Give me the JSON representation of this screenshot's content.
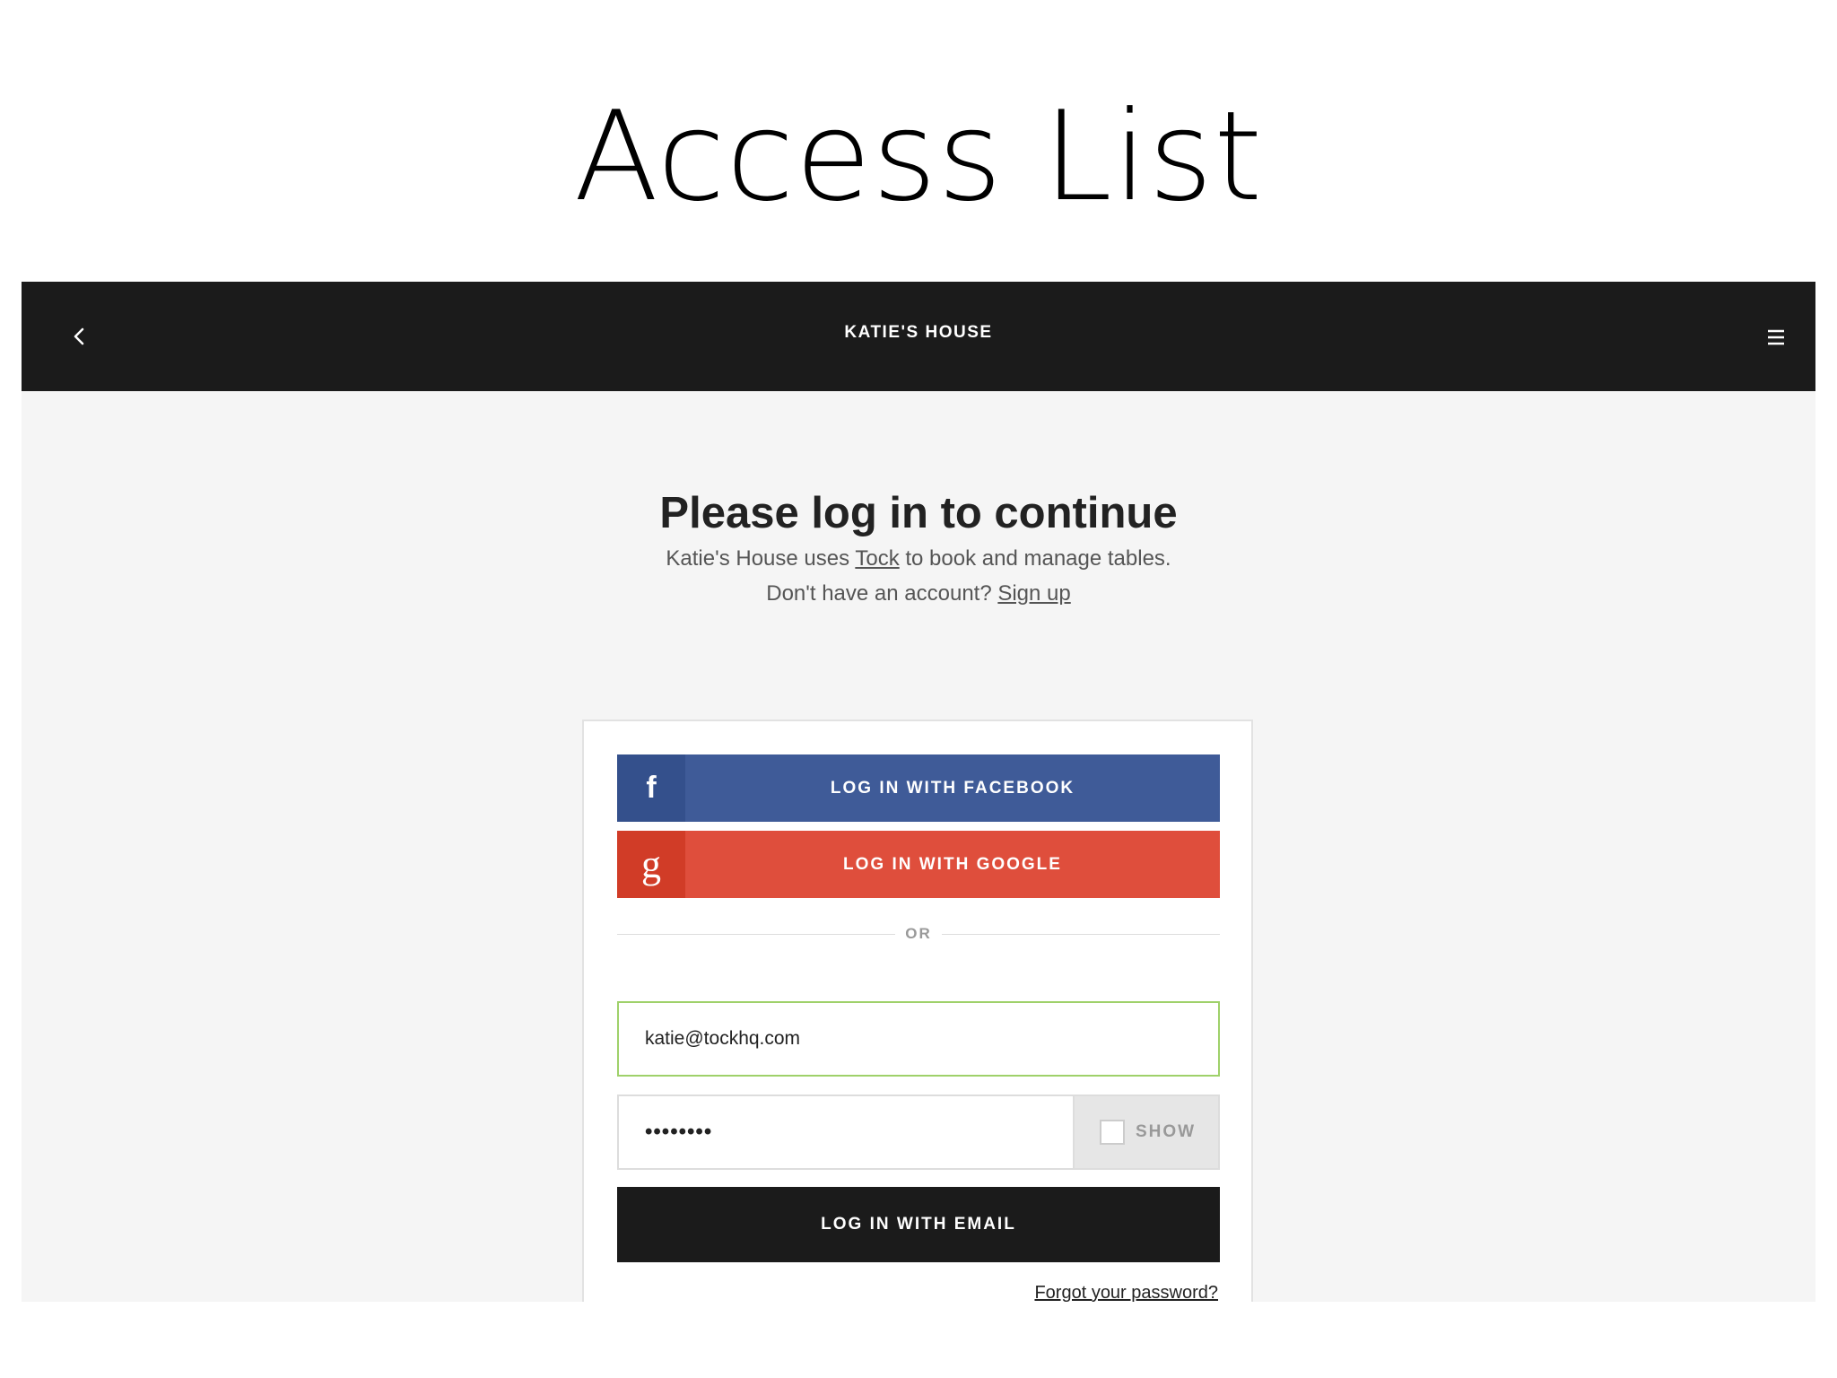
{
  "slide": {
    "title": "Access List"
  },
  "header": {
    "back_icon": "chevron-left-icon",
    "title": "KATIE'S HOUSE",
    "menu_icon": "hamburger-menu-icon"
  },
  "intro": {
    "heading": "Please log in to continue",
    "line1_prefix": "Katie's House uses ",
    "line1_link": "Tock",
    "line1_suffix": " to book and manage tables.",
    "line2_prefix": "Don't have an account? ",
    "line2_link": "Sign up"
  },
  "login": {
    "facebook": {
      "icon_glyph": "f",
      "icon": "facebook-icon",
      "label": "LOG IN WITH FACEBOOK"
    },
    "google": {
      "icon_glyph": "g",
      "icon": "google-icon",
      "label": "LOG IN WITH GOOGLE"
    },
    "divider_text": "OR",
    "email": {
      "value": "katie@tockhq.com"
    },
    "password": {
      "masked_value": "••••••••",
      "show_label": "SHOW",
      "show_checked": false
    },
    "submit_label": "LOG IN WITH EMAIL",
    "forgot_label": "Forgot your password?"
  },
  "colors": {
    "header_bg": "#1b1b1b",
    "page_bg": "#f5f5f5",
    "facebook": "#3f5b98",
    "google": "#df4e3c",
    "email_focus_border": "#9fd16a"
  }
}
